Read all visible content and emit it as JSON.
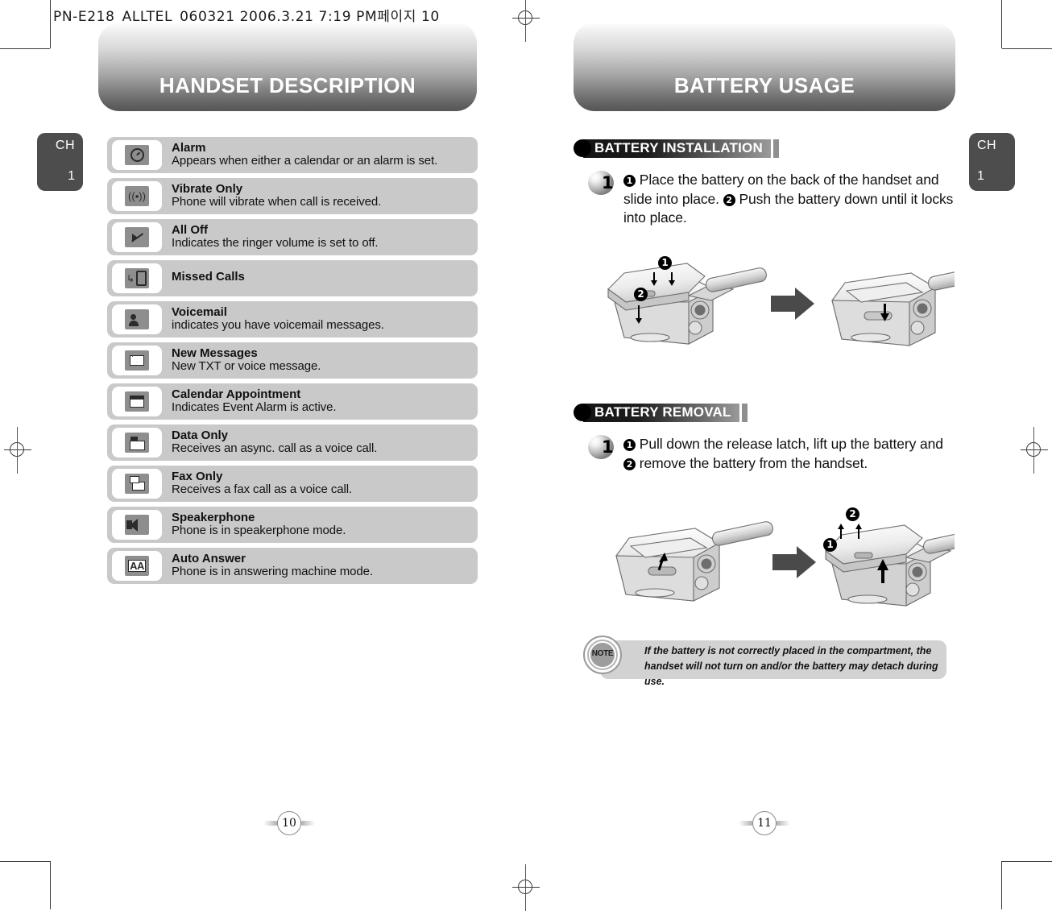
{
  "file_header": "PN-E218_ALLTEL_060321  2006.3.21 7:19 PM페이지 10",
  "chapter_tab": {
    "label": "CH",
    "number": "1"
  },
  "left_page": {
    "banner_title": "HANDSET DESCRIPTION",
    "page_number": "10",
    "icon_rows": [
      {
        "icon": "alarm-clock-icon",
        "title": "Alarm",
        "desc": "Appears when either a calendar or an alarm is set."
      },
      {
        "icon": "vibrate-icon",
        "title": "Vibrate Only",
        "desc": "Phone will vibrate when call is received."
      },
      {
        "icon": "ringer-off-icon",
        "title": "All Off",
        "desc": "Indicates the ringer volume is set to off."
      },
      {
        "icon": "missed-call-icon",
        "title": "Missed Calls",
        "desc": ""
      },
      {
        "icon": "voicemail-icon",
        "title": "Voicemail",
        "desc": "indicates you have voicemail messages."
      },
      {
        "icon": "envelope-icon",
        "title": "New Messages",
        "desc": "New TXT or voice message."
      },
      {
        "icon": "calendar-icon",
        "title": "Calendar Appointment",
        "desc": "Indicates Event Alarm is active."
      },
      {
        "icon": "data-only-icon",
        "title": "Data Only",
        "desc": "Receives an async. call as a voice call."
      },
      {
        "icon": "fax-icon",
        "title": "Fax Only",
        "desc": "Receives a fax call as a voice call."
      },
      {
        "icon": "speaker-icon",
        "title": "Speakerphone",
        "desc": "Phone is in speakerphone mode."
      },
      {
        "icon": "auto-answer-icon",
        "title": "Auto Answer",
        "desc": "Phone is in answering machine mode."
      }
    ]
  },
  "right_page": {
    "banner_title": "BATTERY USAGE",
    "page_number": "11",
    "sections": [
      {
        "heading": "BATTERY INSTALLATION",
        "step_number": "1",
        "text_part1": "Place the battery on the back of the handset and slide into place.",
        "text_part2": "Push the battery down until it locks into place.",
        "marker1": "1",
        "marker2": "2",
        "figure_callout_1": "1",
        "figure_callout_2": "2"
      },
      {
        "heading": "BATTERY REMOVAL",
        "step_number": "1",
        "text_part1": "Pull down the release latch, lift up the battery and",
        "text_part2": "remove the battery from the handset.",
        "marker1": "1",
        "marker2": "2",
        "figure_callout_1": "1",
        "figure_callout_2": "2"
      }
    ],
    "note": {
      "badge_label": "NOTE",
      "text": "If the battery is not correctly placed in the compartment, the handset will not turn on and/or the battery may detach during use."
    }
  },
  "colors": {
    "row_bg": "#c9c9c9",
    "tab_bg": "#4d4d4d",
    "note_bg": "#d2d2d2",
    "banner_dark": "#565656"
  }
}
